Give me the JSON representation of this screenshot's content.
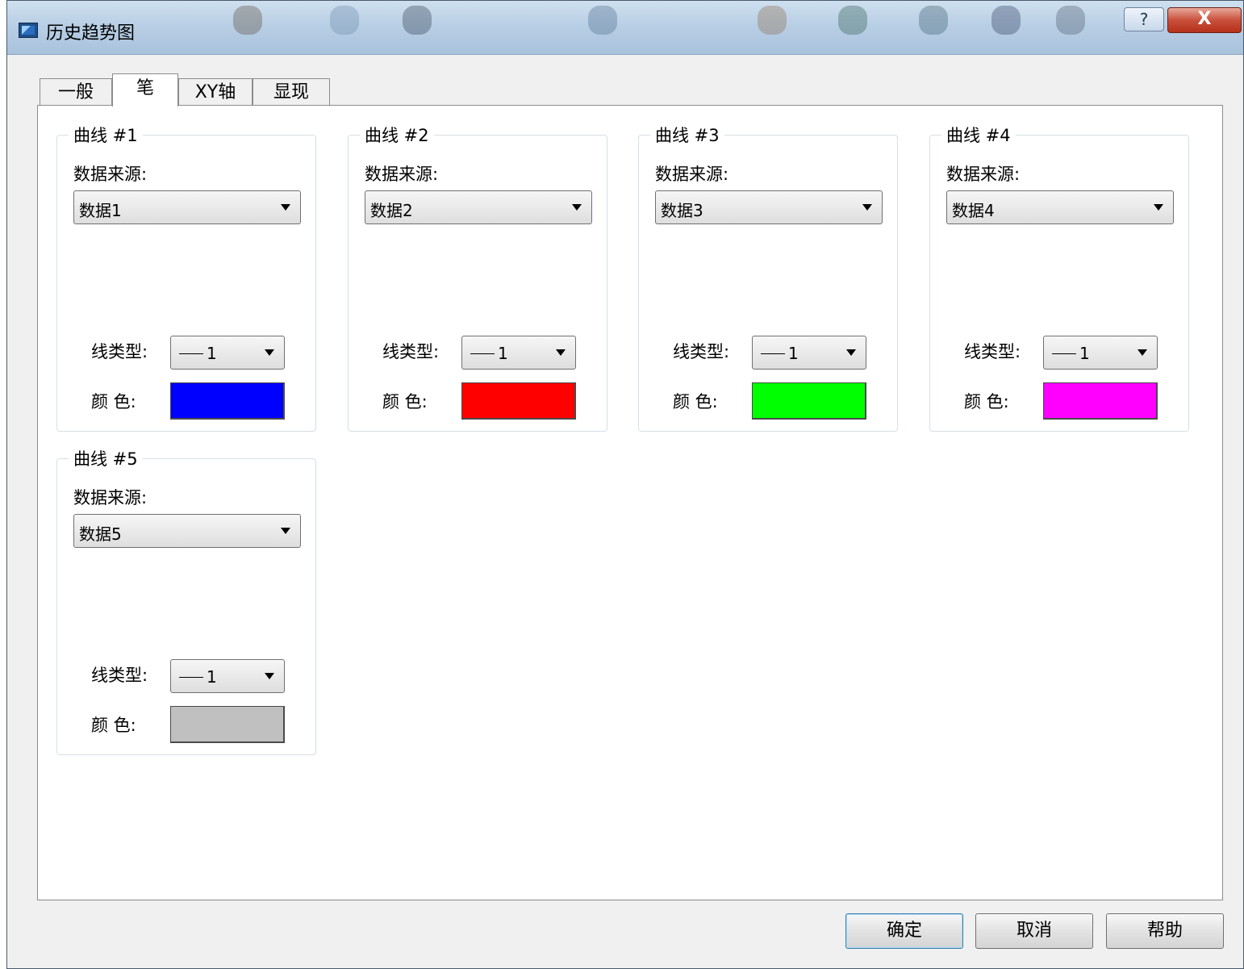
{
  "window": {
    "title": "历史趋势图",
    "help_label": "?",
    "close_label": "X"
  },
  "tabs": [
    {
      "label": "一般",
      "active": false
    },
    {
      "label": "笔",
      "active": true
    },
    {
      "label": "XY轴",
      "active": false
    },
    {
      "label": "显现",
      "active": false
    }
  ],
  "common": {
    "source_label": "数据来源:",
    "line_type_label": "线类型:",
    "color_label": "颜  色:"
  },
  "curves": [
    {
      "title": "曲线 #1",
      "source": "数据1",
      "line_type": "1",
      "color": "#0000ff"
    },
    {
      "title": "曲线 #2",
      "source": "数据2",
      "line_type": "1",
      "color": "#ff0000"
    },
    {
      "title": "曲线 #3",
      "source": "数据3",
      "line_type": "1",
      "color": "#00ff00"
    },
    {
      "title": "曲线 #4",
      "source": "数据4",
      "line_type": "1",
      "color": "#ff00ff"
    },
    {
      "title": "曲线 #5",
      "source": "数据5",
      "line_type": "1",
      "color": "#c0c0c0"
    }
  ],
  "buttons": {
    "ok": "确定",
    "cancel": "取消",
    "help": "帮助"
  }
}
